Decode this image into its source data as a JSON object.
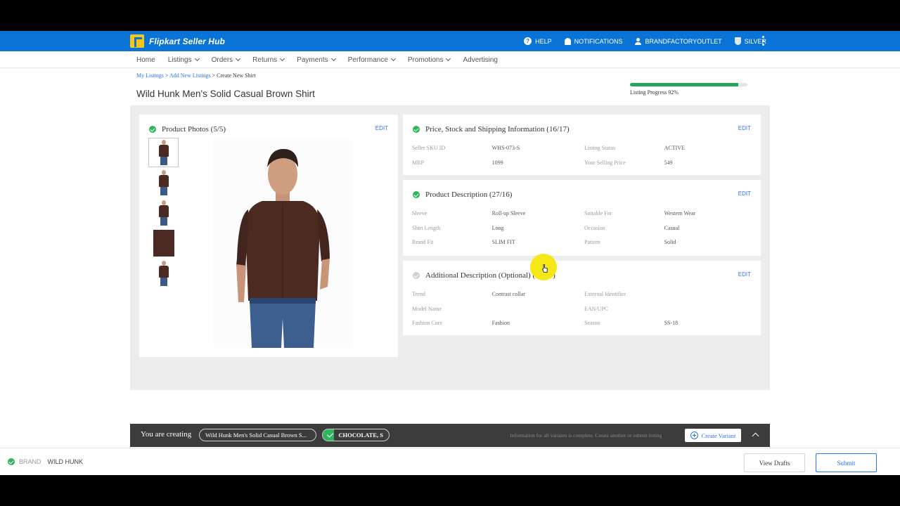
{
  "topbar": {
    "logo_text": "Flipkart Seller Hub",
    "help": "HELP",
    "notifications": "NOTIFICATIONS",
    "seller": "BRANDFACTORYOUTLET",
    "tier": "SILVER",
    "bg_color": "#0a73d6"
  },
  "nav": {
    "items": [
      "Home",
      "Listings",
      "Orders",
      "Returns",
      "Payments",
      "Performance",
      "Promotions",
      "Advertising"
    ]
  },
  "breadcrumb": {
    "my_listings": "My Listings",
    "sep1": " > ",
    "add_new": "Add New Listings",
    "sep2": " > ",
    "current": "Create New Shirt"
  },
  "page_title": "Wild Hunk Men's Solid Casual Brown Shirt",
  "progress": {
    "label": "Listing Progress 92%",
    "value": 0.92
  },
  "photos": {
    "title": "Product Photos (5/5)",
    "edit": "EDIT"
  },
  "price": {
    "title": "Price, Stock and Shipping Information (16/17)",
    "edit": "EDIT",
    "rows": [
      [
        "Seller SKU ID",
        "WHS-073-S",
        "Listing Status",
        "ACTIVE"
      ],
      [
        "MRP",
        "1099",
        "Your Selling Price",
        "549"
      ]
    ]
  },
  "description": {
    "title": "Product Description (27/16)",
    "edit": "EDIT",
    "rows": [
      [
        "Sleeve",
        "Roll-up Sleeve",
        "Suitable For",
        "Western Wear"
      ],
      [
        "Shirt Length",
        "Long",
        "Occasion",
        "Casual"
      ],
      [
        "Brand Fit",
        "SLIM FIT",
        "Pattern",
        "Solid"
      ]
    ]
  },
  "additional": {
    "title": "Additional Description (Optional) (28/23)",
    "edit": "EDIT",
    "rows": [
      [
        "Trend",
        "Contrast collar",
        "External Identifier",
        ""
      ],
      [
        "Model Name",
        "",
        "EAN/UPC",
        ""
      ],
      [
        "Fashion Core",
        "Fashion",
        "Season",
        "SS-18"
      ]
    ]
  },
  "creating_bar": {
    "label": "You are creating",
    "product_pill": "Wild Hunk Men's Solid Casual Brown S...",
    "variant_pill": "CHOCOLATE, S",
    "info": "Information for all variants is complete. Create another or submit listing",
    "create_variant": "Create Variant"
  },
  "footer": {
    "brand_key": "BRAND",
    "brand_value": "WILD HUNK",
    "view_drafts": "View Drafts",
    "submit": "Submit"
  }
}
